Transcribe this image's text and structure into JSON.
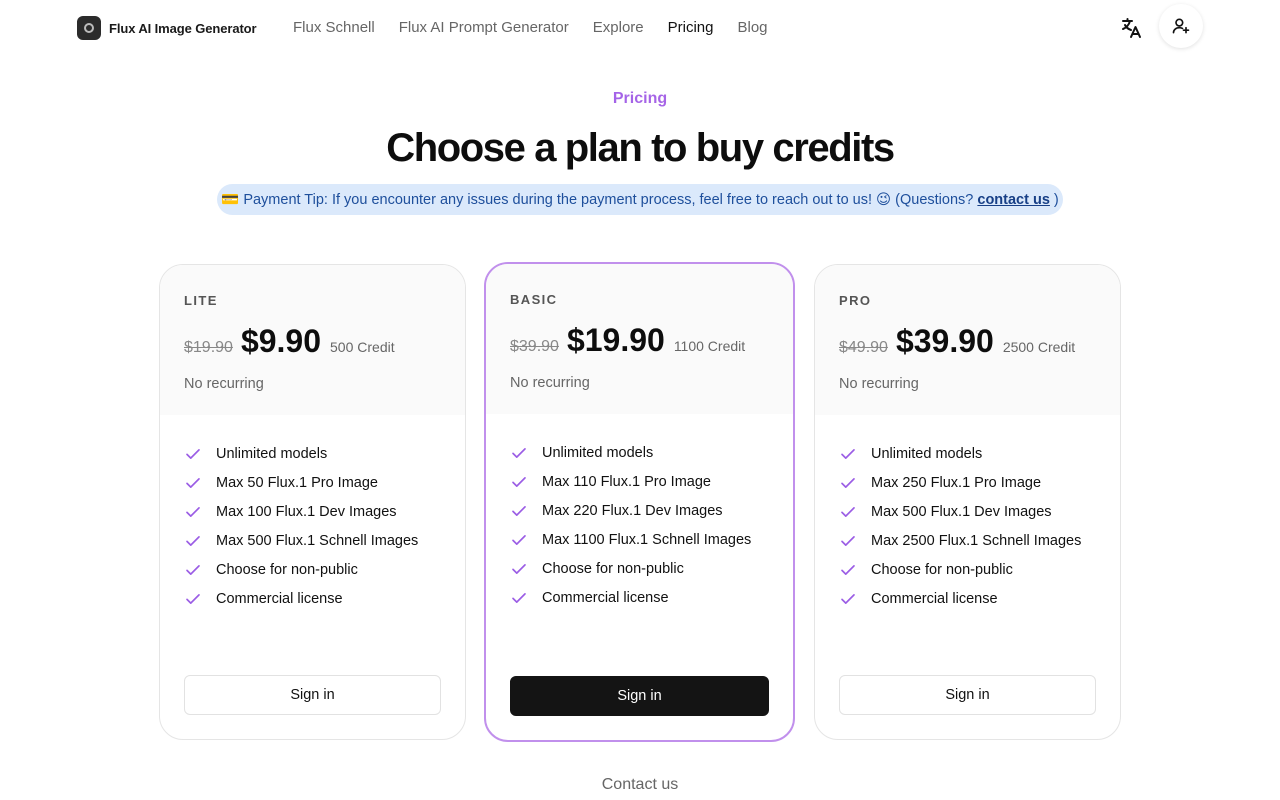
{
  "header": {
    "brand": "Flux AI Image Generator",
    "nav": [
      {
        "label": "Flux Schnell",
        "active": false
      },
      {
        "label": "Flux AI Prompt Generator",
        "active": false
      },
      {
        "label": "Explore",
        "active": false
      },
      {
        "label": "Pricing",
        "active": true
      },
      {
        "label": "Blog",
        "active": false
      }
    ],
    "icons": {
      "language": "translate-icon",
      "user": "user-plus-icon"
    }
  },
  "hero": {
    "eyebrow": "Pricing",
    "title": "Choose a plan to buy credits",
    "tip_prefix": "💳 Payment Tip: If you encounter any issues during the payment process, feel free to reach out to us! 😉 (Questions? ",
    "tip_link": "contact us",
    "tip_suffix": " )"
  },
  "plans": [
    {
      "tier": "LITE",
      "old_price": "$19.90",
      "price": "$9.90",
      "credit": "500 Credit",
      "recurring": "No recurring",
      "features": [
        "Unlimited models",
        "Max 50 Flux.1 Pro Image",
        "Max 100 Flux.1 Dev Images",
        "Max 500 Flux.1 Schnell Images",
        "Choose for non-public",
        "Commercial license"
      ],
      "button": "Sign in"
    },
    {
      "tier": "BASIC",
      "old_price": "$39.90",
      "price": "$19.90",
      "credit": "1100 Credit",
      "recurring": "No recurring",
      "features": [
        "Unlimited models",
        "Max 110 Flux.1 Pro Image",
        "Max 220 Flux.1 Dev Images",
        "Max 1100 Flux.1 Schnell Images",
        "Choose for non-public",
        "Commercial license"
      ],
      "button": "Sign in"
    },
    {
      "tier": "PRO",
      "old_price": "$49.90",
      "price": "$39.90",
      "credit": "2500 Credit",
      "recurring": "No recurring",
      "features": [
        "Unlimited models",
        "Max 250 Flux.1 Pro Image",
        "Max 500 Flux.1 Dev Images",
        "Max 2500 Flux.1 Schnell Images",
        "Choose for non-public",
        "Commercial license"
      ],
      "button": "Sign in"
    }
  ],
  "footer": {
    "contact": "Contact us"
  },
  "colors": {
    "accent": "#9b5de5",
    "featured_border": "#c190ec",
    "check": "#9b5de5",
    "tip_bg": "#dbe9fb",
    "dark_button": "#141414"
  }
}
